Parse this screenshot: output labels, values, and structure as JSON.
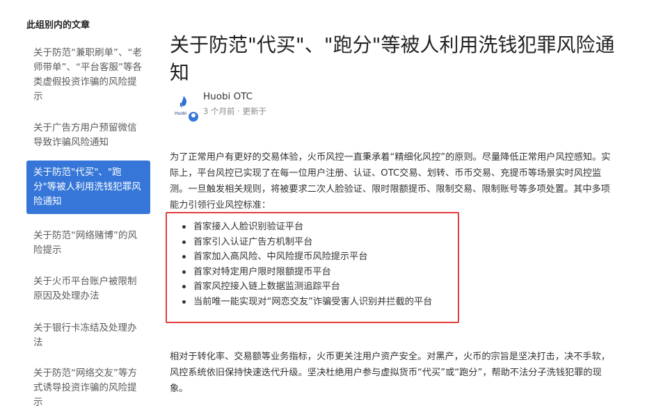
{
  "sidebar": {
    "title": "此组别内的文章",
    "items": [
      {
        "label": "关于防范“兼职刷单”、“老师带单”、“平台客服”等各类虚假投资诈骗的风险提示"
      },
      {
        "label": "关于广告方用户预留微信导致诈骗风险通知"
      },
      {
        "label": "关于防范\"代买\"、\"跑分\"等被人利用洗钱犯罪风险通知"
      },
      {
        "label": "关于防范“网络赌博”的风险提示"
      },
      {
        "label": "关于火币平台账户被限制原因及处理办法"
      },
      {
        "label": "关于银行卡冻结及处理办法"
      },
      {
        "label": "关于防范“网络交友”等方式诱导投资诈骗的风险提示"
      }
    ]
  },
  "article": {
    "title": "关于防范\"代买\"、\"跑分\"等被人利用洗钱犯罪风险通知",
    "author": {
      "name": "Huobi OTC",
      "avatar_text": "Huobi",
      "meta": "3 个月前 · 更新于"
    },
    "paragraph1": "为了正常用户有更好的交易体验，火币风控一直秉承着“精细化风控”的原则。尽量降低正常用户风控感知。实际上，平台风控已实现了在每一位用户注册、认证、OTC交易、划转、币币交易、充提币等场景实时风控监测。一旦触发相关规则，将被要求二次人脸验证、限时限额提币、限制交易、限制账号等多项处置。其中多项能力引领行业风控标准：",
    "features": [
      "首家接入人脸识别验证平台",
      "首家引入认证广告方机制平台",
      "首家加入高风险、中风险提币风险提示平台",
      "首家对特定用户限时限额提币平台",
      "首家风控接入链上数据监测追踪平台",
      "当前唯一能实现对“网恋交友”诈骗受害人识别并拦截的平台"
    ],
    "paragraph2": "相对于转化率、交易额等业务指标，火币更关注用户资产安全。对黑产，火币的宗旨是坚决打击，决不手软，风控系统依旧保持快速迭代升级。坚决杜绝用户参与虚拟货币“代买”或“跑分”，帮助不法分子洗钱犯罪的现象。"
  },
  "colors": {
    "accent": "#3576d8",
    "highlight_border": "#e23c3c"
  }
}
